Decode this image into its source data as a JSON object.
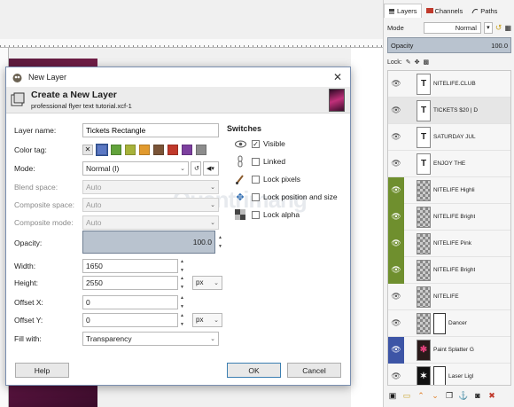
{
  "dock": {
    "tabs": [
      {
        "label": "Layers",
        "icon": "layers-tab-icon"
      },
      {
        "label": "Channels",
        "icon": "channels-tab-icon"
      },
      {
        "label": "Paths",
        "icon": "paths-tab-icon"
      }
    ],
    "mode_label": "Mode",
    "mode_value": "Normal",
    "opacity_label": "Opacity",
    "opacity_value": "100.0",
    "lock_label": "Lock:",
    "layers": [
      {
        "name": "NITELIFE.CLUB",
        "thumb": "text",
        "style": ""
      },
      {
        "name": "TICKETS $20 | D",
        "thumb": "text",
        "style": "sel"
      },
      {
        "name": "SATURDAY JUL",
        "thumb": "text",
        "style": ""
      },
      {
        "name": "ENJOY THE",
        "thumb": "text",
        "style": ""
      },
      {
        "name": "NITELIFE Highli",
        "thumb": "checker",
        "style": "green"
      },
      {
        "name": "NITELIFE Bright",
        "thumb": "checker",
        "style": "green"
      },
      {
        "name": "NITELIFE Pink",
        "thumb": "checker",
        "style": "green"
      },
      {
        "name": "NITELIFE Bright",
        "thumb": "checker",
        "style": "green"
      },
      {
        "name": "NITELIFE",
        "thumb": "checker",
        "style": ""
      },
      {
        "name": "Dancer",
        "thumb": "checker",
        "style": "",
        "mask": true
      },
      {
        "name": "Paint Splatter G",
        "thumb": "pink",
        "style": "blue"
      },
      {
        "name": "Laser Ligl",
        "thumb": "dark",
        "style": "",
        "mask": true
      }
    ],
    "bottom_icons": [
      "new-layer-icon",
      "new-group-icon",
      "raise-icon",
      "lower-icon",
      "duplicate-icon",
      "anchor-icon",
      "mask-icon",
      "delete-icon"
    ]
  },
  "dialog": {
    "title": "New Layer",
    "heading": "Create a New Layer",
    "subheading": "professional flyer text tutorial.xcf-1",
    "fields": {
      "layer_name_label": "Layer name:",
      "layer_name_value": "Tickets Rectangle",
      "color_tag_label": "Color tag:",
      "mode_label": "Mode:",
      "mode_value": "Normal (l)",
      "blend_space_label": "Blend space:",
      "blend_space_value": "Auto",
      "composite_space_label": "Composite space:",
      "composite_space_value": "Auto",
      "composite_mode_label": "Composite mode:",
      "composite_mode_value": "Auto",
      "opacity_label": "Opacity:",
      "opacity_value": "100.0",
      "width_label": "Width:",
      "width_value": "1650",
      "height_label": "Height:",
      "height_value": "2550",
      "unit_value": "px",
      "offset_x_label": "Offset X:",
      "offset_x_value": "0",
      "offset_y_label": "Offset Y:",
      "offset_y_value": "0",
      "fill_label": "Fill with:",
      "fill_value": "Transparency"
    },
    "color_tags": [
      "#d0d0d0",
      "#5b78c4",
      "#62a33c",
      "#a7b23a",
      "#e19a2e",
      "#7a5437",
      "#c0392b",
      "#7c3f9e",
      "#8c8c8c"
    ],
    "switches": {
      "title": "Switches",
      "items": [
        {
          "label": "Visible",
          "checked": true,
          "icon": "eye-icon"
        },
        {
          "label": "Linked",
          "checked": false,
          "icon": "chain-icon"
        },
        {
          "label": "Lock pixels",
          "checked": false,
          "icon": "brush-icon"
        },
        {
          "label": "Lock position and size",
          "checked": false,
          "icon": "move-icon"
        },
        {
          "label": "Lock alpha",
          "checked": false,
          "icon": "checker-icon"
        }
      ]
    },
    "buttons": {
      "help": "Help",
      "ok": "OK",
      "cancel": "Cancel"
    }
  }
}
